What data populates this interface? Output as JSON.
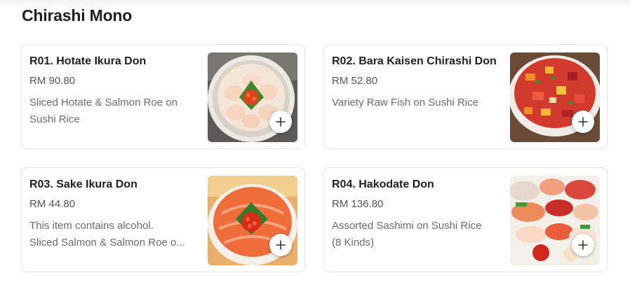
{
  "section": {
    "title": "Chirashi Mono"
  },
  "colors": {
    "add_icon": "#333333",
    "card_border": "#e3e3e3"
  },
  "items": [
    {
      "name": "R01. Hotate Ikura Don",
      "price": "RM 90.80",
      "description_lines": [
        "Sliced Hotate & Salmon Roe on",
        "Sushi Rice"
      ],
      "image_icon": "scallop-roe-bowl-photo",
      "action_icon": "plus-icon"
    },
    {
      "name": "R02. Bara Kaisen Chirashi Don",
      "price": "RM 52.80",
      "description_lines": [
        "Variety Raw Fish on Sushi Rice"
      ],
      "image_icon": "diced-fish-bowl-photo",
      "action_icon": "plus-icon"
    },
    {
      "name": "R03. Sake Ikura Don",
      "price": "RM 44.80",
      "description_lines": [
        "This item contains alcohol.",
        "Sliced Salmon & Salmon Roe o..."
      ],
      "image_icon": "salmon-roe-bowl-photo",
      "action_icon": "plus-icon"
    },
    {
      "name": "R04. Hakodate Don",
      "price": "RM 136.80",
      "description_lines": [
        "Assorted Sashimi on Sushi Rice",
        "(8 Kinds)"
      ],
      "image_icon": "sashimi-bowl-photo",
      "action_icon": "plus-icon"
    }
  ]
}
